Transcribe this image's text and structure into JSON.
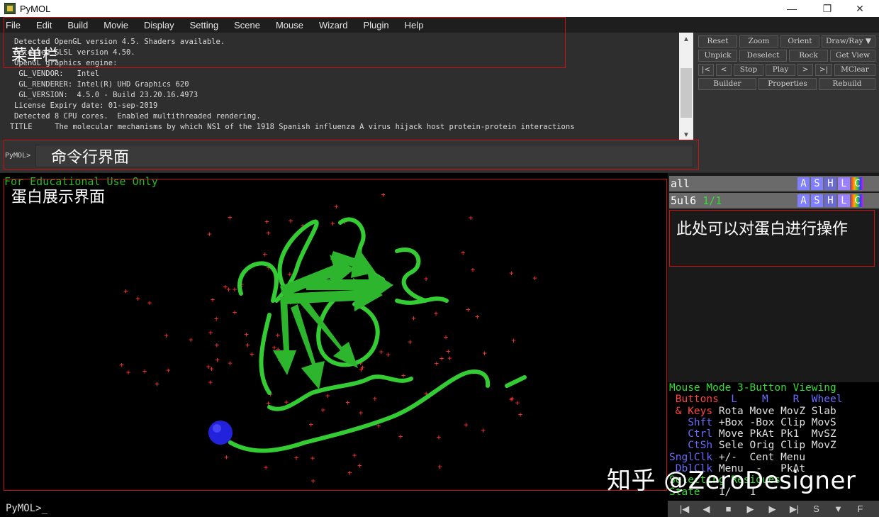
{
  "window": {
    "title": "PyMOL",
    "minimize": "—",
    "maximize": "❐",
    "close": "✕"
  },
  "menu": [
    "File",
    "Edit",
    "Build",
    "Movie",
    "Display",
    "Setting",
    "Scene",
    "Mouse",
    "Wizard",
    "Plugin",
    "Help"
  ],
  "console": {
    "lines": [
      "Detected OpenGL version 4.5. Shaders available.",
      "Detected GLSL version 4.50.",
      "OpenGL graphics engine:",
      " GL_VENDOR:   Intel",
      " GL_RENDERER: Intel(R) UHD Graphics 620",
      " GL_VERSION:  4.5.0 - Build 23.20.16.4973",
      "License Expiry date: 01-sep-2019",
      "Detected 8 CPU cores.  Enabled multithreaded rendering.",
      "",
      "TITLE     The molecular mechanisms by which NS1 of the 1918 Spanish influenza A virus hijack host protein-protein interactions"
    ]
  },
  "command": {
    "prompt": "PyMOL>"
  },
  "buttons": {
    "row1": [
      "Reset",
      "Zoom",
      "Orient",
      "Draw/Ray ▼"
    ],
    "row2": [
      "Unpick",
      "Deselect",
      "Rock",
      "Get View"
    ],
    "row3": [
      "|<",
      "<",
      "Stop",
      "Play",
      ">",
      ">|",
      "MClear"
    ],
    "row4": [
      "Builder",
      "Properties",
      "Rebuild"
    ]
  },
  "viewer": {
    "watermark_text": "For Educational Use Only"
  },
  "objects": [
    {
      "name": "all",
      "state": "",
      "buttons": [
        "A",
        "S",
        "H",
        "L",
        "C"
      ]
    },
    {
      "name": "5ul6",
      "state": "1/1",
      "buttons": [
        "A",
        "S",
        "H",
        "L",
        "C"
      ]
    }
  ],
  "mouse_panel": {
    "mode_label": "Mouse Mode ",
    "mode_value": "3-Button Viewing",
    "buttons_label": "Buttons",
    "buttons_cols": "  L    M    R  Wheel",
    "rows": [
      {
        "key": " & Keys",
        "vals": " Rota Move MovZ Slab"
      },
      {
        "key": "   Shft",
        "vals": " +Box -Box Clip MovS"
      },
      {
        "key": "   Ctrl",
        "vals": " Move PkAt Pk1  MvSZ"
      },
      {
        "key": "   CtSh",
        "vals": " Sele Orig Clip MovZ"
      },
      {
        "key": "SnglClk",
        "vals": " +/-  Cent Menu"
      },
      {
        "key": "DblClk",
        "vals": " Menu  -   PkAt"
      }
    ],
    "selecting_label": "Selecting Residues",
    "state_label": "State",
    "state_value": "   1/   1"
  },
  "bottom_prompt": "PyMOL>",
  "playback": [
    "|◀",
    "◀",
    "■",
    "▶",
    "▶",
    "▶|",
    "S",
    "▼",
    "F"
  ],
  "annotations": {
    "menu_bar": "菜单栏",
    "command_line": "命令行界面",
    "protein_view": "蛋白展示界面",
    "object_panel": "此处可以对蛋白进行操作"
  },
  "site_watermark": "知乎 @ZeroDesigner",
  "colors": {
    "ribbon": "#33cc33",
    "water": "#ff3333",
    "ion": "#2222dd",
    "annotation": "#cc1111"
  }
}
